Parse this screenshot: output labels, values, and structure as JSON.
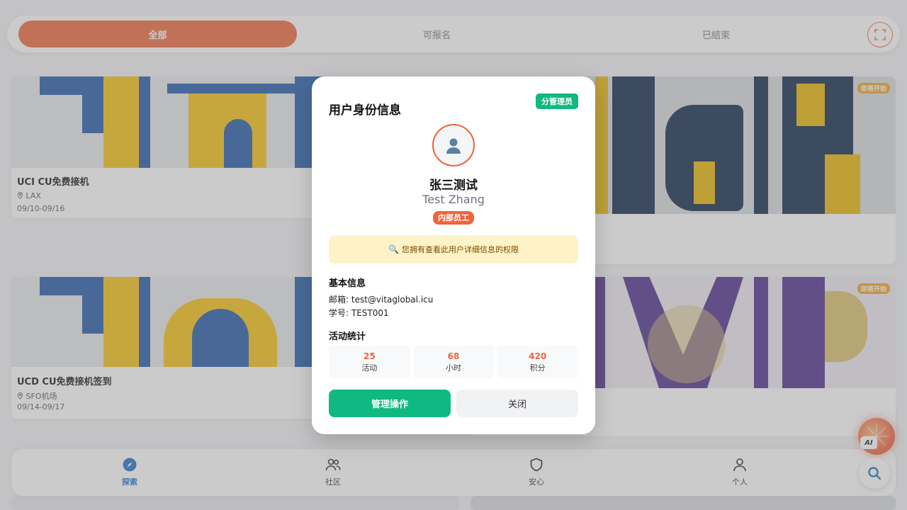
{
  "tabs": [
    {
      "label": "全部",
      "active": true
    },
    {
      "label": "可报名",
      "active": false
    },
    {
      "label": "已结束",
      "active": false
    }
  ],
  "cards": [
    {
      "title": "UCI CU免费接机",
      "location": "LAX",
      "date": "09/10-09/16"
    },
    {
      "title": "UCD CU免费接机签到",
      "location": "SFO机场",
      "date": "09/14-09/17"
    }
  ],
  "soon_badge": "即将开始",
  "bottom_nav": [
    {
      "label": "探索",
      "icon": "compass-icon",
      "active": true
    },
    {
      "label": "社区",
      "icon": "people-icon",
      "active": false
    },
    {
      "label": "安心",
      "icon": "shield-icon",
      "active": false
    },
    {
      "label": "个人",
      "icon": "person-icon",
      "active": false
    }
  ],
  "ai_label": "AI",
  "modal": {
    "title": "用户身份信息",
    "role_badge": "分管理员",
    "avatar_icon": "user-silhouette-icon",
    "name_cn": "张三测试",
    "name_en": "Test Zhang",
    "staff_badge": "内部员工",
    "permission_icon": "magnifier-icon",
    "permission_text": "您拥有查看此用户详细信息的权限",
    "basic_title": "基本信息",
    "email_label": "邮箱:",
    "email": "test@vitaglobal.icu",
    "student_id_label": "学号:",
    "student_id": "TEST001",
    "stats_title": "活动统计",
    "stats": [
      {
        "value": "25",
        "label": "活动"
      },
      {
        "value": "68",
        "label": "小时"
      },
      {
        "value": "420",
        "label": "积分"
      }
    ],
    "admin_button": "管理操作",
    "close_button": "关闭"
  },
  "colors": {
    "accent": "#f0643c",
    "success": "#10b981",
    "nav_active": "#1a6fc9",
    "notice_bg": "#fef3c7"
  }
}
